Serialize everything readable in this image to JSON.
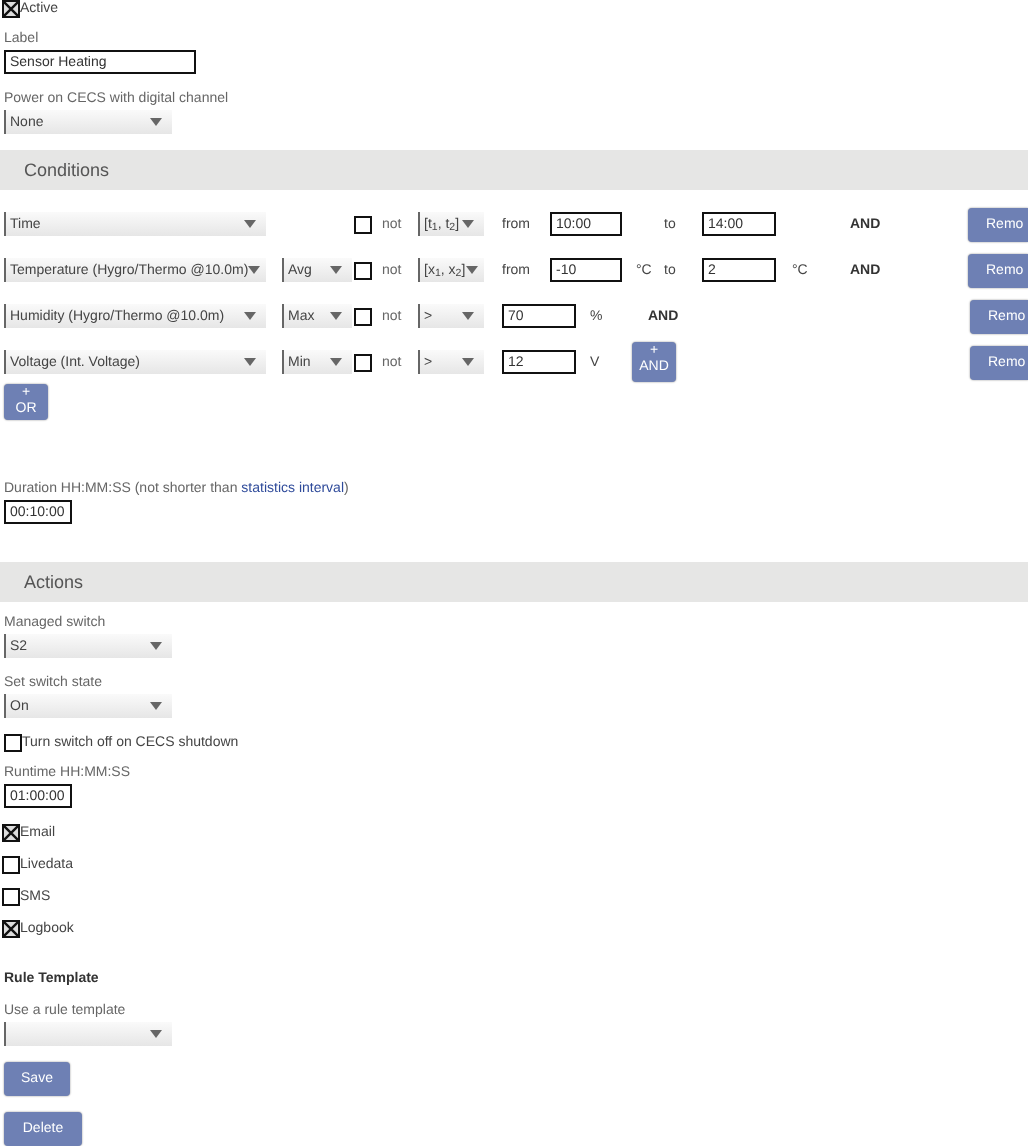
{
  "active": {
    "label": "Active",
    "checked": true
  },
  "label_field": {
    "label": "Label",
    "value": "Sensor Heating"
  },
  "power_channel": {
    "label": "Power on CECS with digital channel",
    "value": "None"
  },
  "conditions": {
    "title": "Conditions",
    "rows": [
      {
        "metric": "Time",
        "negate_label": "not",
        "negated": false,
        "operator": "[t$_{1}$, t$_{2}$]",
        "from_label": "from",
        "value_1": "10:00",
        "to_label": "to",
        "value_2": "14:00",
        "connector": {
          "kind": "text",
          "label": "AND"
        },
        "remove": "Remo"
      },
      {
        "metric": "Temperature (Hygro/Thermo @10.0m)",
        "aggregate": "Avg",
        "negate_label": "not",
        "negated": false,
        "operator": "[x$_{1}$, x$_{2}$]",
        "from_label": "from",
        "value_1": "-10",
        "unit_1": "°C",
        "to_label": "to",
        "value_2": "2",
        "unit_2": "°C",
        "connector": {
          "kind": "text",
          "label": "AND"
        },
        "remove": "Remo"
      },
      {
        "metric": "Humidity (Hygro/Thermo @10.0m)",
        "aggregate": "Max",
        "negate_label": "not",
        "negated": false,
        "operator": ">",
        "value_1": "70",
        "unit_1": "%",
        "connector": {
          "kind": "text",
          "label": "AND"
        },
        "remove": "Remo"
      },
      {
        "metric": "Voltage (Int. Voltage)",
        "aggregate": "Min",
        "negate_label": "not",
        "negated": false,
        "operator": ">",
        "value_1": "12",
        "unit_1": "V",
        "connector": {
          "kind": "button",
          "symbol": "+",
          "label": "AND"
        },
        "remove": "Remo"
      }
    ],
    "or_button": {
      "symbol": "+",
      "label": "OR"
    }
  },
  "duration": {
    "label": "Duration HH:MM:SS (not shorter than ",
    "link": "statistics interval",
    "suffix": ")",
    "value": "00:10:00"
  },
  "actions": {
    "title": "Actions",
    "managed_switch": {
      "label": "Managed switch",
      "value": "S2"
    },
    "switch_state": {
      "label": "Set switch state",
      "value": "On"
    },
    "turn_off": {
      "label": "Turn switch off on CECS shutdown",
      "checked": false
    },
    "runtime": {
      "label": "Runtime HH:MM:SS",
      "value": "01:00:00"
    },
    "notifications": [
      {
        "label": "Email",
        "checked": true
      },
      {
        "label": "Livedata",
        "checked": false
      },
      {
        "label": "SMS",
        "checked": false
      },
      {
        "label": "Logbook",
        "checked": true
      }
    ]
  },
  "rule_template": {
    "title": "Rule Template",
    "label": "Use a rule template"
  },
  "buttons": [
    "Save",
    "Delete"
  ]
}
